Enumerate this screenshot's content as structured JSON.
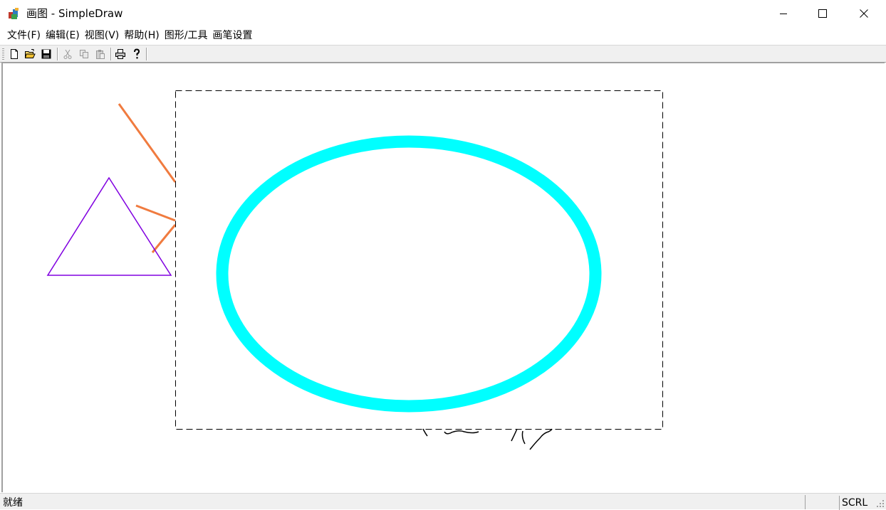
{
  "window": {
    "title": "画图 - SimpleDraw",
    "controls": {
      "minimize": "minimize-icon",
      "maximize": "maximize-icon",
      "close": "close-icon"
    }
  },
  "menu": [
    "文件(F)",
    "编辑(E)",
    "视图(V)",
    "帮助(H)",
    "图形/工具",
    "画笔设置"
  ],
  "toolbar": {
    "buttons": [
      {
        "icon": "new-file-icon",
        "enabled": true
      },
      {
        "icon": "open-folder-icon",
        "enabled": true
      },
      {
        "icon": "save-disk-icon",
        "enabled": true
      },
      {
        "icon": "cut-icon",
        "enabled": false
      },
      {
        "icon": "copy-icon",
        "enabled": false
      },
      {
        "icon": "paste-icon",
        "enabled": false
      },
      {
        "icon": "print-icon",
        "enabled": true
      },
      {
        "icon": "help-icon",
        "enabled": true
      }
    ]
  },
  "canvas": {
    "shapes": [
      {
        "type": "line",
        "color": "#f07b3f"
      },
      {
        "type": "line",
        "color": "#f07b3f"
      },
      {
        "type": "line",
        "color": "#f07b3f"
      },
      {
        "type": "triangle",
        "color": "#8000e0"
      },
      {
        "type": "ellipse",
        "color": "#00ffff"
      },
      {
        "type": "freehand",
        "color": "#000000"
      },
      {
        "type": "selection-rectangle",
        "color": "#000000"
      }
    ]
  },
  "status": {
    "message": "就绪",
    "indicator": "SCRL"
  }
}
